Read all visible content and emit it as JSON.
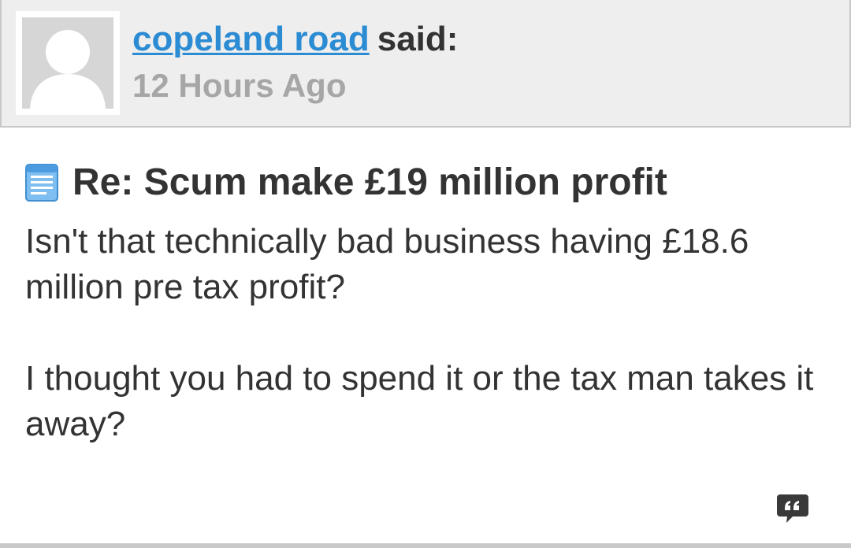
{
  "post": {
    "author": "copeland road",
    "said_label": "said:",
    "timestamp": "12 Hours Ago",
    "title": "Re: Scum make £19 million profit",
    "body": [
      "Isn't that technically bad business having £18.6 million pre tax profit?",
      "I thought you had to spend it or the tax man takes it away?"
    ]
  },
  "icons": {
    "avatar": "default-user-silhouette",
    "title": "document-icon",
    "quote": "quote-bubble-icon"
  },
  "colors": {
    "author_link": "#2b8bd3",
    "header_background": "#eeeeee",
    "timestamp": "#a6a6a6",
    "text": "#333333"
  }
}
